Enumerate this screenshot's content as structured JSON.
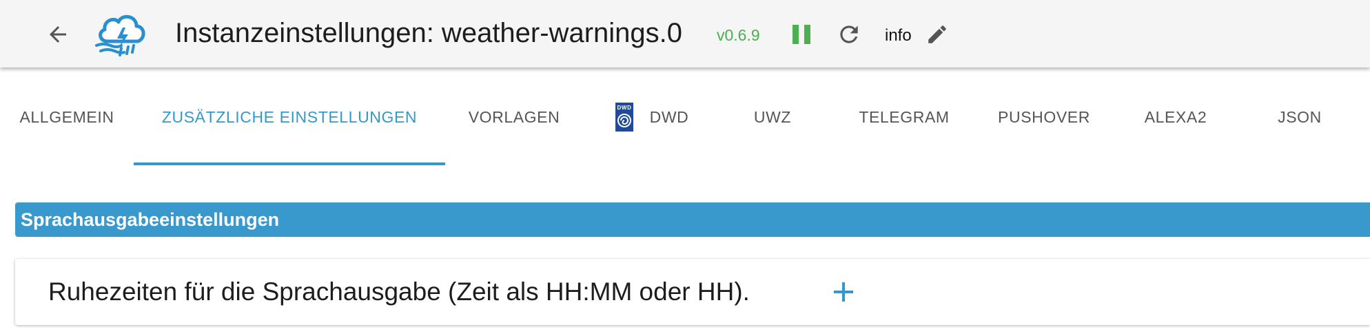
{
  "header": {
    "title": "Instanzeinstellungen: weather-warnings.0",
    "version": "v0.6.9",
    "info_label": "info",
    "icons": {
      "back": "arrow-left-icon",
      "logo": "weather-cloud-lightning-icon",
      "pause": "pause-icon",
      "reload": "reload-icon",
      "edit": "pencil-icon"
    }
  },
  "tabs": [
    {
      "label": "ALLGEMEIN"
    },
    {
      "label": "ZUSÄTZLICHE EINSTELLUNGEN"
    },
    {
      "label": "VORLAGEN"
    },
    {
      "label": "DWD",
      "icon": "dwd-logo-icon",
      "icon_text": "DWD"
    },
    {
      "label": "UWZ"
    },
    {
      "label": "TELEGRAM"
    },
    {
      "label": "PUSHOVER"
    },
    {
      "label": "ALEXA2"
    },
    {
      "label": "JSON"
    }
  ],
  "active_tab": "ZUSÄTZLICHE EINSTELLUNGEN",
  "section": {
    "title": "Sprachausgabeeinstellungen"
  },
  "card": {
    "label": "Ruhezeiten für die Sprachausgabe (Zeit als HH:MM oder HH).",
    "add_icon": "plus-icon"
  },
  "colors": {
    "accent": "#3399cc",
    "version_green": "#4caf50",
    "section_bg": "#3a99cc",
    "header_bg": "#f5f5f5"
  }
}
